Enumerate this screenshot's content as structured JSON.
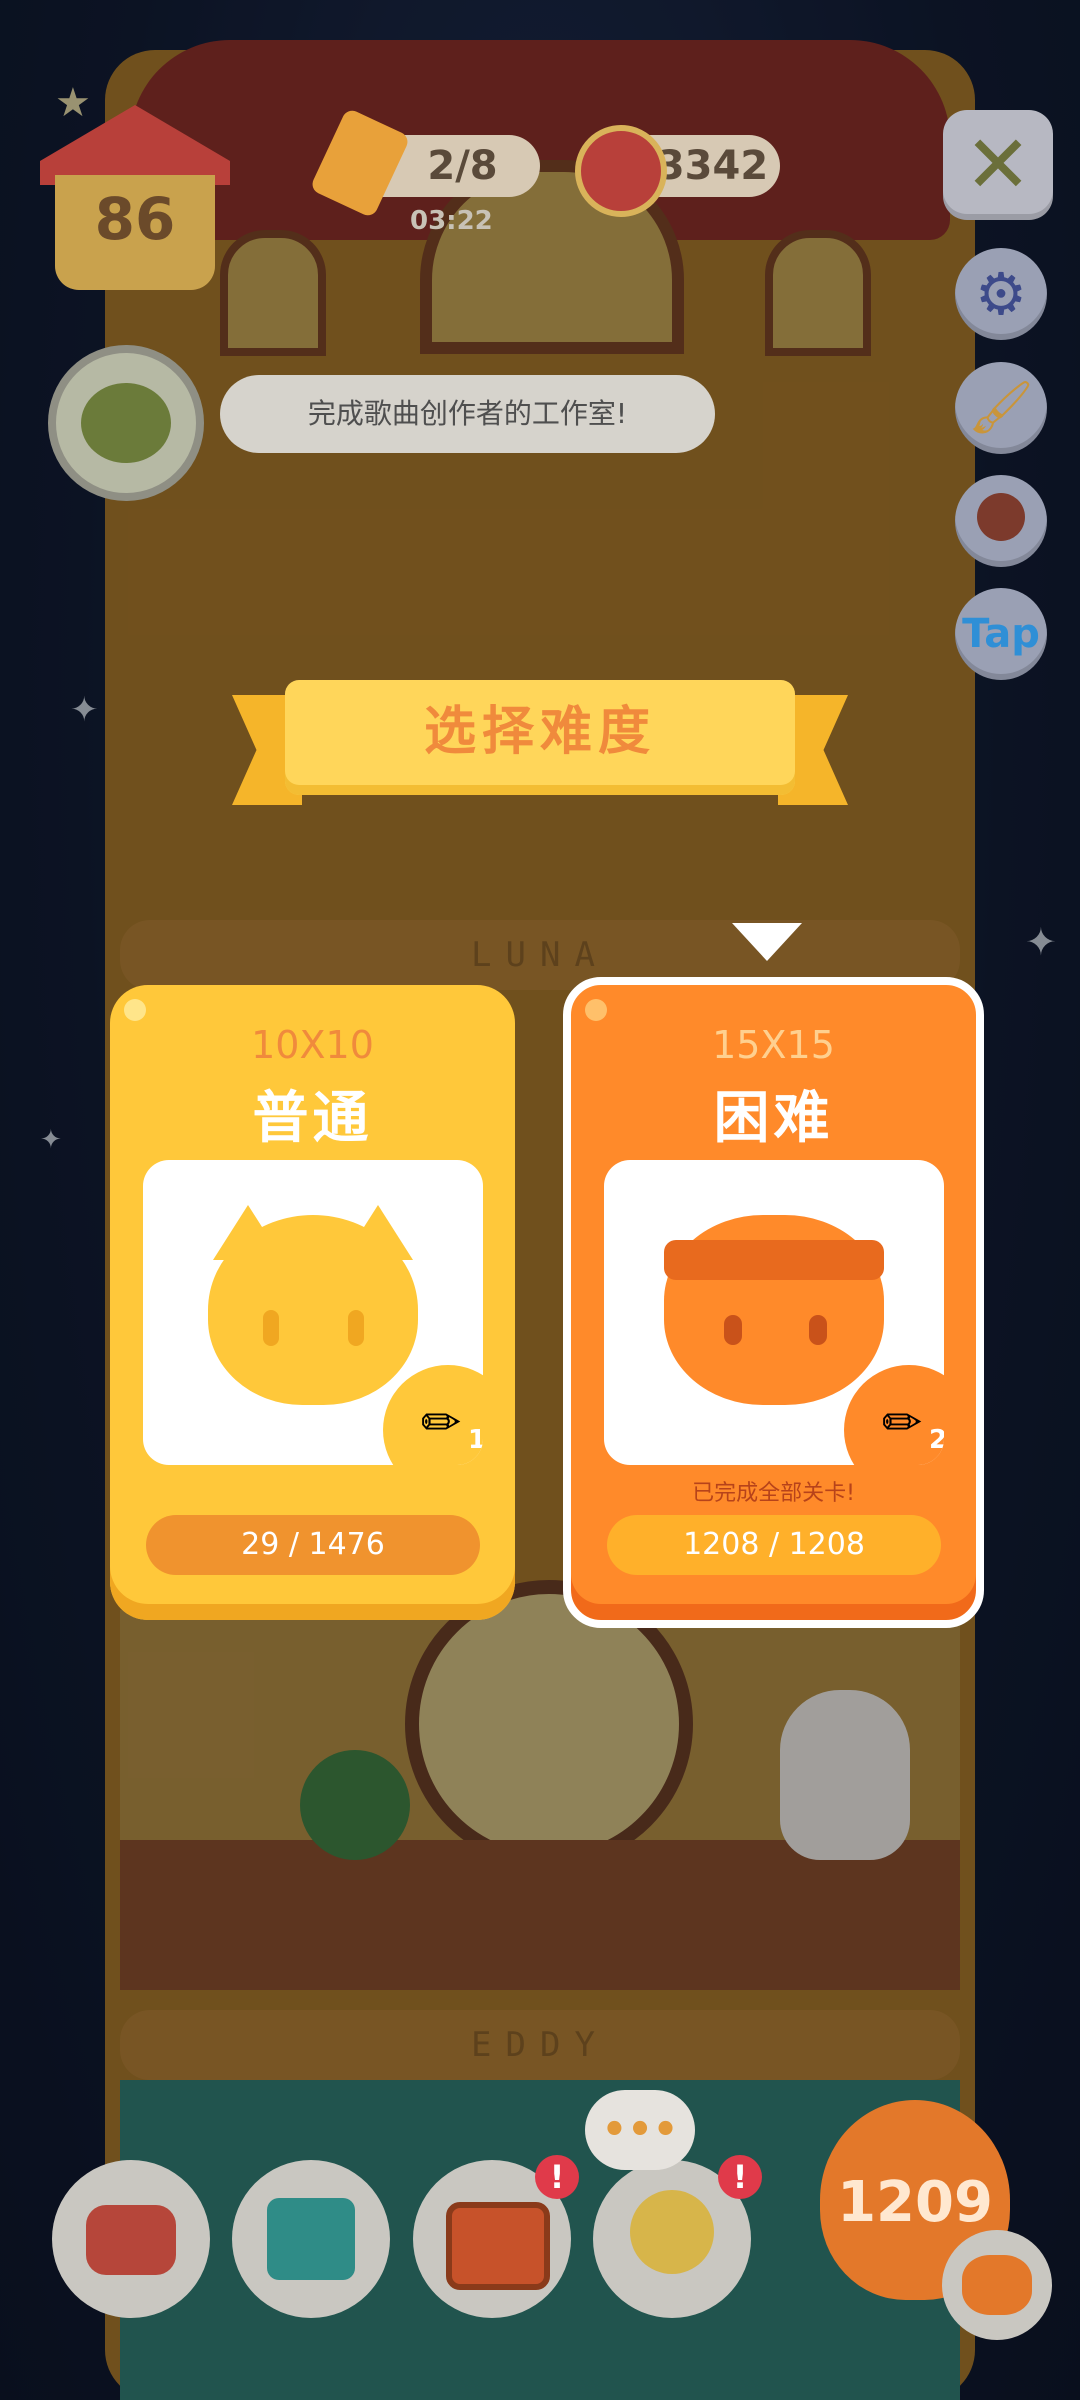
{
  "hud": {
    "house_level": "86",
    "pencil_count": "2/8",
    "timer": "03:22",
    "coins": "3342"
  },
  "quest": {
    "message": "完成歌曲创作者的工作室!"
  },
  "side": {
    "tap_label": "Tap"
  },
  "dialog": {
    "title": "选择难度",
    "cards": [
      {
        "grid_size": "10X10",
        "name": "普通",
        "pencil_cost": "1",
        "progress_current": "29",
        "progress_total": "1476",
        "progress_text": "29 / 1476",
        "completed_text": ""
      },
      {
        "grid_size": "15X15",
        "name": "困难",
        "pencil_cost": "2",
        "progress_current": "1208",
        "progress_total": "1208",
        "progress_text": "1208 / 1208",
        "completed_text": "已完成全部关卡!"
      }
    ]
  },
  "floors": {
    "luna_sign": "LUNA",
    "eddy_sign": "EDDY"
  },
  "bottom": {
    "big_counter": "1209",
    "badge_symbol": "!"
  },
  "colors": {
    "normal_card": "#ffc83a",
    "hard_card": "#ff8a2a",
    "title_banner": "#ffd65a",
    "title_text": "#f08a3c"
  },
  "icons": {
    "house": "house-icon",
    "pencil": "pencil-icon",
    "coin_can": "coin-can-icon",
    "close": "close-icon",
    "settings": "gear-icon",
    "paint": "paint-brush-icon",
    "stamp": "stamp-icon",
    "sofa": "sofa-icon",
    "book": "book-icon",
    "tv": "tv-icon",
    "crystal_ball": "crystal-ball-icon",
    "cat": "cat-icon"
  }
}
